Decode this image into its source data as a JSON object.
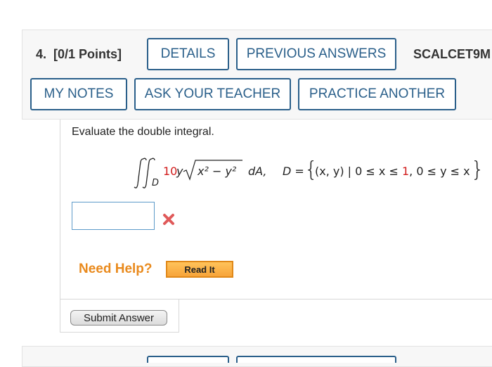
{
  "question": {
    "number_label": "4.",
    "points_label": "[0/1 Points]",
    "buttons": {
      "details": "DETAILS",
      "previous_answers": "PREVIOUS ANSWERS",
      "my_notes": "MY NOTES",
      "ask_teacher": "ASK YOUR TEACHER",
      "practice_another": "PRACTICE ANOTHER"
    },
    "source_code": "SCALCET9M"
  },
  "content": {
    "prompt": "Evaluate the double integral.",
    "math": {
      "region_sub": "D",
      "coefficient": "10",
      "integrand_factor": "y",
      "radicand": "x² − y²",
      "differential": "dA,",
      "domain_lhs": "D =",
      "set_open": "{",
      "set_expr_1": "(x, y) | 0 ≤ x ≤ ",
      "x_upper": "1",
      "set_expr_2": ", 0 ≤ y ≤ x",
      "set_close": "}"
    },
    "answer_value": "",
    "answer_status": "incorrect"
  },
  "help": {
    "label": "Need Help?",
    "read_it": "Read It"
  },
  "submit": {
    "label": "Submit Answer"
  },
  "colors": {
    "accent_blue": "#2a5f8a",
    "error_red": "#d11a1a",
    "help_orange": "#e98a1d"
  },
  "icons": {
    "wrong": "x-mark-icon"
  }
}
